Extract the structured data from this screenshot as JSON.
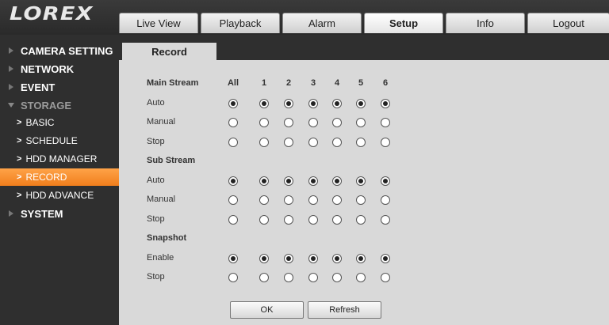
{
  "brand": {
    "logo_text": "LOREX"
  },
  "top_tabs": [
    {
      "label": "Live View",
      "active": false
    },
    {
      "label": "Playback",
      "active": false
    },
    {
      "label": "Alarm",
      "active": false
    },
    {
      "label": "Setup",
      "active": true
    },
    {
      "label": "Info",
      "active": false
    },
    {
      "label": "Logout",
      "active": false
    }
  ],
  "sidebar": {
    "items": [
      {
        "label": "CAMERA SETTING"
      },
      {
        "label": "NETWORK"
      },
      {
        "label": "EVENT"
      },
      {
        "label": "STORAGE"
      },
      {
        "label": "BASIC"
      },
      {
        "label": "SCHEDULE"
      },
      {
        "label": "HDD MANAGER"
      },
      {
        "label": "RECORD",
        "selected": true
      },
      {
        "label": "HDD ADVANCE"
      },
      {
        "label": "SYSTEM"
      }
    ]
  },
  "page": {
    "tab_label": "Record",
    "columns": [
      "All",
      "1",
      "2",
      "3",
      "4",
      "5",
      "6"
    ],
    "sections": [
      {
        "title": "Main Stream",
        "rows": [
          {
            "label": "Auto",
            "checked": true
          },
          {
            "label": "Manual",
            "checked": false
          },
          {
            "label": "Stop",
            "checked": false
          }
        ]
      },
      {
        "title": "Sub Stream",
        "rows": [
          {
            "label": "Auto",
            "checked": true
          },
          {
            "label": "Manual",
            "checked": false
          },
          {
            "label": "Stop",
            "checked": false
          }
        ]
      },
      {
        "title": "Snapshot",
        "rows": [
          {
            "label": "Enable",
            "checked": true
          },
          {
            "label": "Stop",
            "checked": false
          }
        ]
      }
    ],
    "buttons": {
      "ok": "OK",
      "refresh": "Refresh"
    }
  }
}
